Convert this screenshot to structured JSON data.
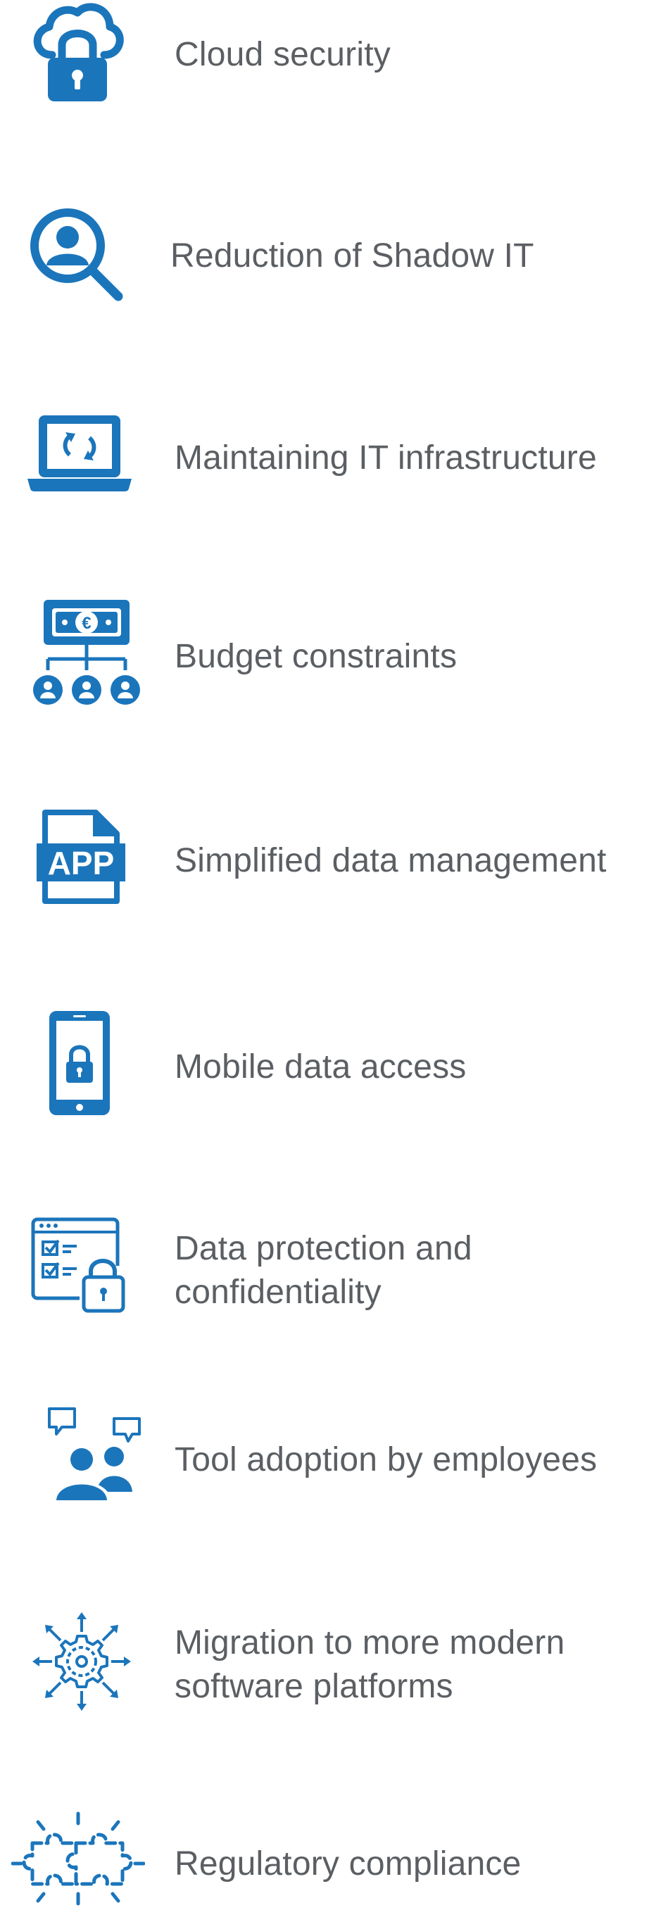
{
  "colors": {
    "icon": "#1b75bb",
    "text": "#5b5f63"
  },
  "items": [
    {
      "icon": "cloud-lock-icon",
      "label": "Cloud security"
    },
    {
      "icon": "user-search-icon",
      "label": "Reduction of Shadow IT"
    },
    {
      "icon": "laptop-refresh-icon",
      "label": "Maintaining IT infrastructure"
    },
    {
      "icon": "budget-team-icon",
      "label": "Budget constraints"
    },
    {
      "icon": "app-file-icon",
      "label": "Simplified data management"
    },
    {
      "icon": "mobile-lock-icon",
      "label": "Mobile data access"
    },
    {
      "icon": "checklist-lock-icon",
      "label": "Data protection and",
      "label2": "confidentiality"
    },
    {
      "icon": "people-chat-icon",
      "label": "Tool adoption by employees"
    },
    {
      "icon": "gear-arrows-icon",
      "label": "Migration to more modern",
      "label2": "software platforms"
    },
    {
      "icon": "puzzle-icon",
      "label": "Regulatory compliance"
    }
  ]
}
